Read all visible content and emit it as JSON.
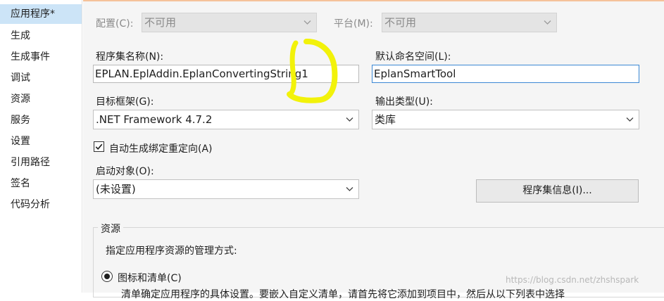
{
  "sidebar": {
    "items": [
      {
        "label": "应用程序*",
        "active": true
      },
      {
        "label": "生成"
      },
      {
        "label": "生成事件"
      },
      {
        "label": "调试"
      },
      {
        "label": "资源"
      },
      {
        "label": "服务"
      },
      {
        "label": "设置"
      },
      {
        "label": "引用路径"
      },
      {
        "label": "签名"
      },
      {
        "label": "代码分析"
      }
    ]
  },
  "config": {
    "label": "配置(C):",
    "value": "不可用"
  },
  "platform": {
    "label": "平台(M):",
    "value": "不可用"
  },
  "assembly_name": {
    "label": "程序集名称(N):",
    "value": "EPLAN.EplAddin.EplanConvertingString1"
  },
  "default_namespace": {
    "label": "默认命名空间(L):",
    "value": "EplanSmartTool"
  },
  "target_framework": {
    "label": "目标框架(G):",
    "value": ".NET Framework 4.7.2"
  },
  "output_type": {
    "label": "输出类型(U):",
    "value": "类库"
  },
  "auto_binding": {
    "label": "自动生成绑定重定向(A)",
    "checked": true
  },
  "startup_object": {
    "label": "启动对象(O):",
    "value": "(未设置)"
  },
  "assembly_info_button": {
    "label": "程序集信息(I)..."
  },
  "resources": {
    "group_label": "资源",
    "description": "指定应用程序资源的管理方式:",
    "radio_label": "图标和清单(C)",
    "cut_text": "清单确定应用程序的具体设置。要嵌入自定义清单，请首先将它添加到项目中，然后从以下列表中选择"
  },
  "watermark": "https://blog.csdn.net/zhshspark",
  "colors": {
    "accent": "#cce4f7",
    "focus_border": "#3b88d4",
    "annotation": "#f2f20a"
  }
}
